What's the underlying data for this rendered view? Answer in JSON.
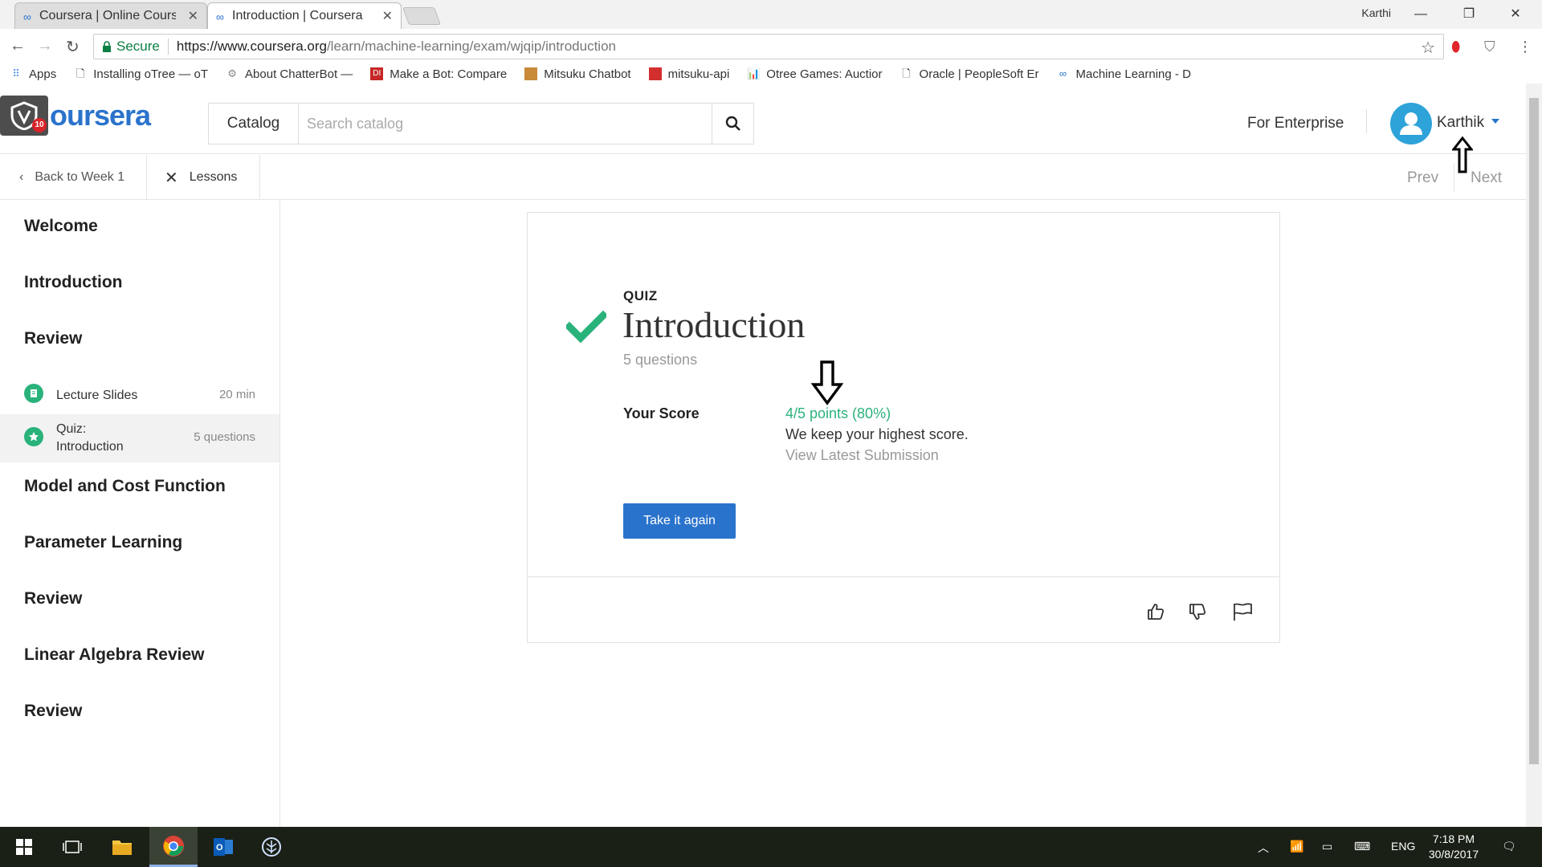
{
  "browser": {
    "tabs": [
      {
        "title": "Coursera | Online Course",
        "active": false
      },
      {
        "title": "Introduction | Coursera",
        "active": true
      }
    ],
    "window_user": "Karthi",
    "secure_label": "Secure",
    "url_host": "https://www.coursera.org",
    "url_path": "/learn/machine-learning/exam/wjqip/introduction",
    "bookmarks": [
      {
        "label": "Apps",
        "icon": "apps-grid-icon"
      },
      {
        "label": "Installing oTree — oT",
        "icon": "page-icon"
      },
      {
        "label": "About ChatterBot —",
        "icon": "bot-icon"
      },
      {
        "label": "Make a Bot: Compare",
        "icon": "di-icon"
      },
      {
        "label": "Mitsuku Chatbot",
        "icon": "mitsuku-icon"
      },
      {
        "label": "mitsuku-api",
        "icon": "mitsuku-api-icon"
      },
      {
        "label": "Otree Games: Auctior",
        "icon": "otree-icon"
      },
      {
        "label": "Oracle | PeopleSoft Er",
        "icon": "page-icon"
      },
      {
        "label": "Machine Learning - D",
        "icon": "coursera-icon"
      }
    ]
  },
  "header": {
    "logo_text": "oursera",
    "logo_badge": "10",
    "catalog_label": "Catalog",
    "search_placeholder": "Search catalog",
    "enterprise_label": "For Enterprise",
    "username": "Karthik"
  },
  "subnav": {
    "back_label": "Back to Week 1",
    "lessons_label": "Lessons",
    "prev_label": "Prev",
    "next_label": "Next"
  },
  "sidebar": {
    "sections": [
      "Welcome",
      "Introduction",
      "Review",
      "Model and Cost Function",
      "Parameter Learning",
      "Review",
      "Linear Algebra Review",
      "Review"
    ],
    "items": [
      {
        "name": "Lecture Slides",
        "meta": "20 min",
        "icon": "document-icon"
      },
      {
        "name_line1": "Quiz:",
        "name_line2": "Introduction",
        "meta": "5 questions",
        "icon": "star-icon"
      }
    ]
  },
  "quiz": {
    "label": "QUIZ",
    "title": "Introduction",
    "count": "5 questions",
    "score_label": "Your Score",
    "score_value": "4/5 points (80%)",
    "score_note": "We keep your highest score.",
    "view_latest": "View Latest Submission",
    "take_again": "Take it again"
  },
  "taskbar": {
    "time": "7:18 PM",
    "date": "30/8/2017",
    "lang": "ENG"
  },
  "colors": {
    "accent": "#2a73cc",
    "success": "#2ab27b"
  }
}
